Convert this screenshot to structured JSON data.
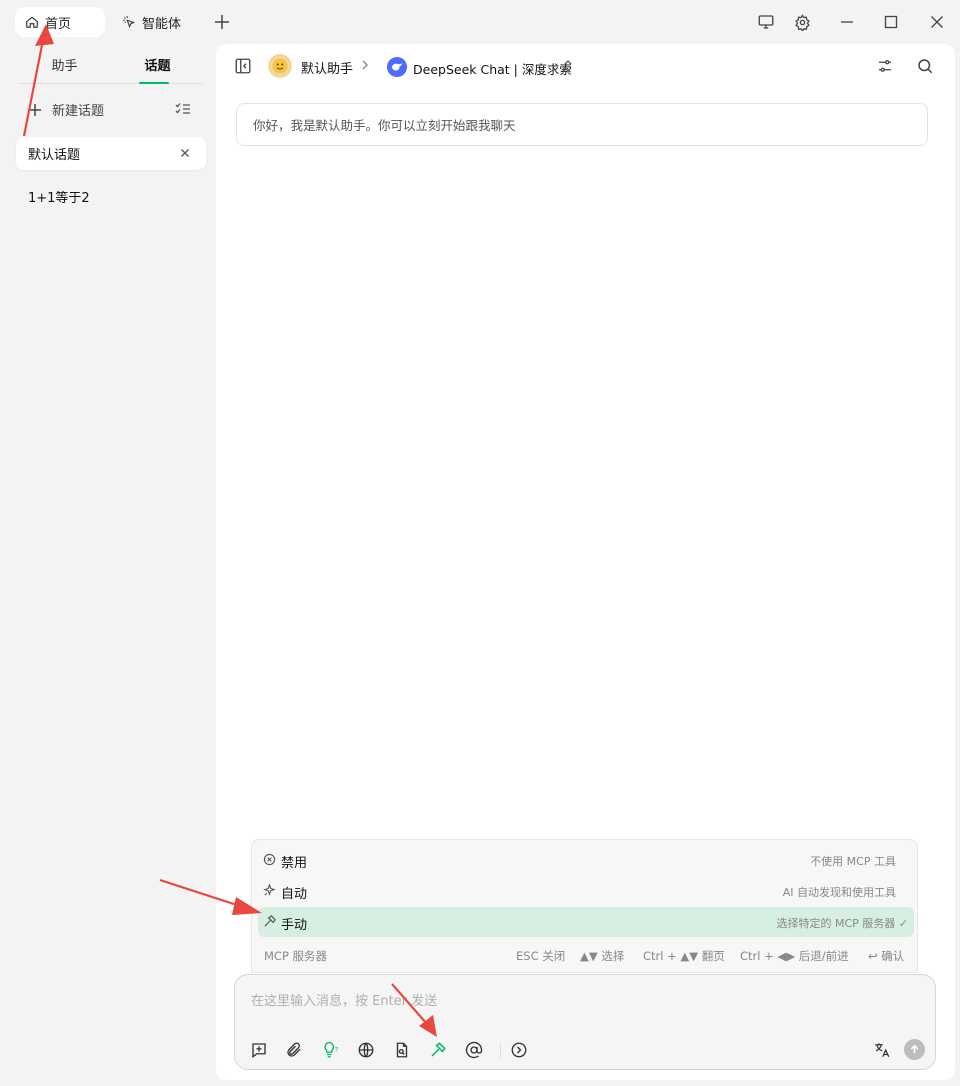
{
  "topbar": {
    "tabs": [
      {
        "label": "首页",
        "icon": "home-icon"
      },
      {
        "label": "智能体",
        "icon": "sparkle-cursor-icon"
      }
    ],
    "actions": [
      "monitor-icon",
      "gear-icon",
      "minimize-icon",
      "maximize-icon",
      "close-icon"
    ]
  },
  "sidebar": {
    "tabs": [
      {
        "label": "助手",
        "active": false
      },
      {
        "label": "话题",
        "active": true
      }
    ],
    "new_topic_label": "新建话题",
    "topics": [
      {
        "label": "默认话题",
        "active": true
      },
      {
        "label": "1+1等于2",
        "active": false
      }
    ]
  },
  "header": {
    "assistant_name": "默认助手",
    "model_name": "DeepSeek Chat | 深度求索"
  },
  "chat": {
    "welcome": "你好，我是默认助手。你可以立刻开始跟我聊天"
  },
  "mcp_menu": {
    "options": [
      {
        "label": "禁用",
        "desc": "不使用 MCP 工具",
        "icon": "disable-circle-icon",
        "selected": false
      },
      {
        "label": "自动",
        "desc": "AI 自动发现和使用工具",
        "icon": "auto-sparkle-icon",
        "selected": false
      },
      {
        "label": "手动",
        "desc": "选择特定的 MCP 服务器",
        "icon": "hammer-icon",
        "selected": true
      }
    ],
    "footer_title": "MCP 服务器",
    "hints": {
      "esc": "ESC 关闭",
      "select": "▲▼ 选择",
      "page": "Ctrl + ▲▼ 翻页",
      "nav": "Ctrl + ◀▶ 后退/前进",
      "confirm": "↩ 确认"
    }
  },
  "input": {
    "placeholder": "在这里输入消息，按 Enter 发送",
    "toolbar": [
      "new-topic-icon",
      "attachment-icon",
      "bulb-icon",
      "globe-icon",
      "file-search-icon",
      "hammer-icon",
      "at-icon",
      "expand-icon"
    ],
    "accent": "#00b96b"
  },
  "colors": {
    "accent": "#00b96b",
    "selected_row": "#d6efe2",
    "annotation_arrow": "#e8483f"
  }
}
